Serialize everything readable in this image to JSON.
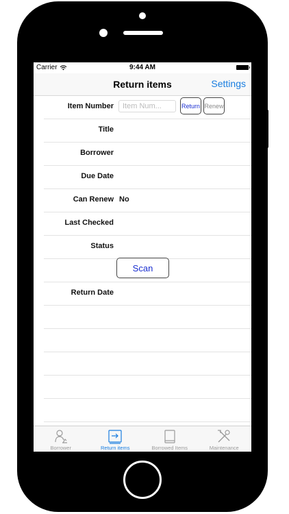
{
  "status_bar": {
    "carrier": "Carrier",
    "time": "9:44 AM"
  },
  "nav": {
    "title": "Return items",
    "settings": "Settings"
  },
  "fields": {
    "item_number_label": "Item Number",
    "item_number_placeholder": "Item Num...",
    "item_number_value": "",
    "return_button": "Return",
    "renew_button": "Renew",
    "title_label": "Title",
    "borrower_label": "Borrower",
    "due_date_label": "Due Date",
    "can_renew_label": "Can Renew",
    "can_renew_value": "No",
    "last_checked_label": "Last Checked",
    "status_label": "Status",
    "scan_button": "Scan",
    "return_date_label": "Return Date"
  },
  "tabs": [
    {
      "label": "Borrower",
      "icon": "borrower-icon",
      "active": false
    },
    {
      "label": "Return items",
      "icon": "return-items-icon",
      "active": true
    },
    {
      "label": "Borrowed Items",
      "icon": "book-icon",
      "active": false
    },
    {
      "label": "Maintenance",
      "icon": "tools-icon",
      "active": false
    }
  ],
  "colors": {
    "accent": "#1a7ee0",
    "button_text": "#1a2fd0",
    "inactive_tab": "#9a9a9a"
  }
}
